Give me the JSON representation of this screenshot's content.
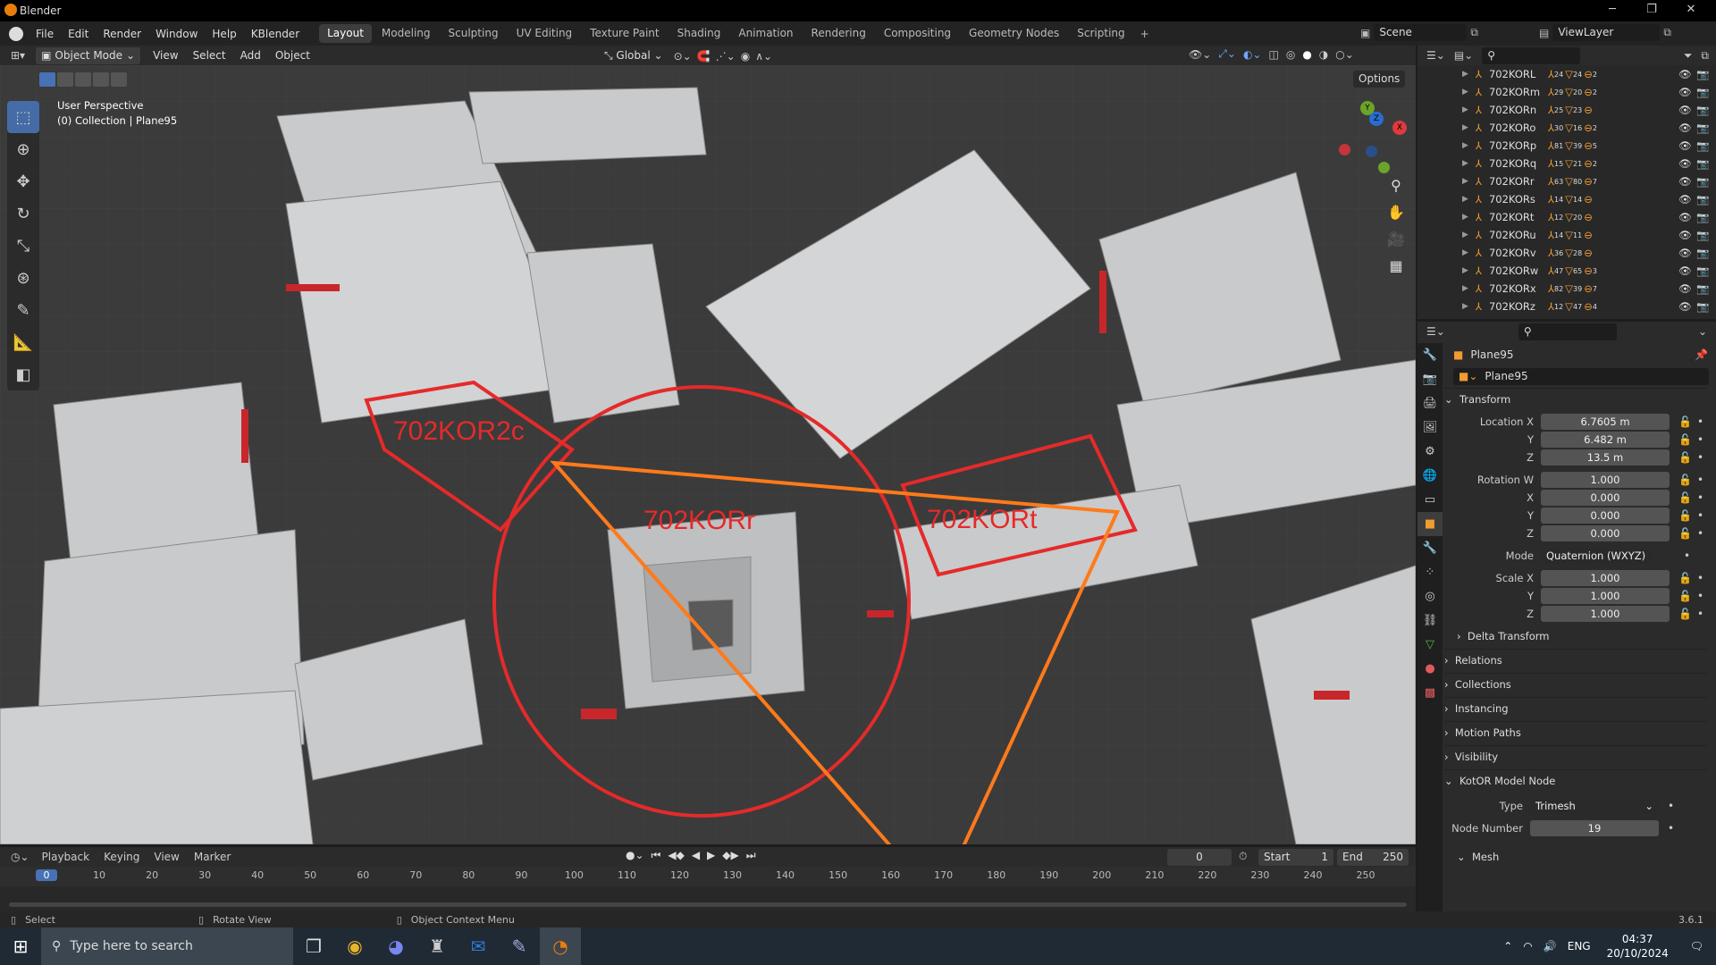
{
  "app": {
    "title": "Blender",
    "version": "3.6.1"
  },
  "menubar": {
    "items": [
      "File",
      "Edit",
      "Render",
      "Window",
      "Help",
      "KBlender"
    ],
    "workspaces": [
      "Layout",
      "Modeling",
      "Sculpting",
      "UV Editing",
      "Texture Paint",
      "Shading",
      "Animation",
      "Rendering",
      "Compositing",
      "Geometry Nodes",
      "Scripting"
    ],
    "active_workspace": "Layout",
    "scene": "Scene",
    "view_layer": "ViewLayer"
  },
  "viewport_header": {
    "mode": "Object Mode",
    "menus": [
      "View",
      "Select",
      "Add",
      "Object"
    ],
    "transform_orientation": "Global",
    "options_label": "Options"
  },
  "viewport": {
    "perspective_label": "User Perspective",
    "collection_label": "(0) Collection | Plane95",
    "annotations": [
      "702KOR2c",
      "702KORr",
      "702KORt"
    ],
    "annotation_color": "#e52a2a",
    "triangle_color": "#ff7a1a",
    "gizmo_axes": [
      "X",
      "Y",
      "Z"
    ]
  },
  "outliner": {
    "rows": [
      {
        "name": "702KORL",
        "c1": "24",
        "c2": "24",
        "c3": "2"
      },
      {
        "name": "702KORm",
        "c1": "29",
        "c2": "20",
        "c3": "2"
      },
      {
        "name": "702KORn",
        "c1": "25",
        "c2": "23",
        "c3": ""
      },
      {
        "name": "702KORo",
        "c1": "30",
        "c2": "16",
        "c3": "2"
      },
      {
        "name": "702KORp",
        "c1": "81",
        "c2": "39",
        "c3": "5"
      },
      {
        "name": "702KORq",
        "c1": "15",
        "c2": "21",
        "c3": "2"
      },
      {
        "name": "702KORr",
        "c1": "63",
        "c2": "80",
        "c3": "7"
      },
      {
        "name": "702KORs",
        "c1": "14",
        "c2": "14",
        "c3": ""
      },
      {
        "name": "702KORt",
        "c1": "12",
        "c2": "20",
        "c3": ""
      },
      {
        "name": "702KORu",
        "c1": "14",
        "c2": "11",
        "c3": ""
      },
      {
        "name": "702KORv",
        "c1": "36",
        "c2": "28",
        "c3": ""
      },
      {
        "name": "702KORw",
        "c1": "47",
        "c2": "65",
        "c3": "3"
      },
      {
        "name": "702KORx",
        "c1": "82",
        "c2": "39",
        "c3": "7"
      },
      {
        "name": "702KORz",
        "c1": "12",
        "c2": "47",
        "c3": "4"
      }
    ]
  },
  "properties": {
    "object_name": "Plane95",
    "data_name": "Plane95",
    "transform_label": "Transform",
    "location": {
      "label": "Location X",
      "x": "6.7605 m",
      "y": "6.482 m",
      "z": "13.5 m"
    },
    "rotation": {
      "label": "Rotation W",
      "w": "1.000",
      "x": "0.000",
      "y": "0.000",
      "z": "0.000"
    },
    "mode": {
      "label": "Mode",
      "value": "Quaternion (WXYZ)"
    },
    "scale": {
      "label": "Scale X",
      "x": "1.000",
      "y": "1.000",
      "z": "1.000"
    },
    "axis_labels": {
      "x": "X",
      "y": "Y",
      "z": "Z"
    },
    "sections": [
      "Delta Transform",
      "Relations",
      "Collections",
      "Instancing",
      "Motion Paths",
      "Visibility",
      "KotOR Model Node"
    ],
    "kotor": {
      "type_label": "Type",
      "type_value": "Trimesh",
      "node_label": "Node Number",
      "node_value": "19",
      "mesh_label": "Mesh"
    }
  },
  "timeline": {
    "menus": [
      "Playback",
      "Keying",
      "View",
      "Marker"
    ],
    "current_frame": "0",
    "start_label": "Start",
    "start": "1",
    "end_label": "End",
    "end": "250",
    "ticks": [
      "0",
      "10",
      "20",
      "30",
      "40",
      "50",
      "60",
      "70",
      "80",
      "90",
      "100",
      "110",
      "120",
      "130",
      "140",
      "150",
      "160",
      "170",
      "180",
      "190",
      "200",
      "210",
      "220",
      "230",
      "240",
      "250"
    ]
  },
  "statusbar": {
    "select": "Select",
    "rotate": "Rotate View",
    "context": "Object Context Menu",
    "version": "3.6.1"
  },
  "taskbar": {
    "search_placeholder": "Type here to search",
    "lang": "ENG",
    "time": "04:37",
    "date": "20/10/2024"
  }
}
